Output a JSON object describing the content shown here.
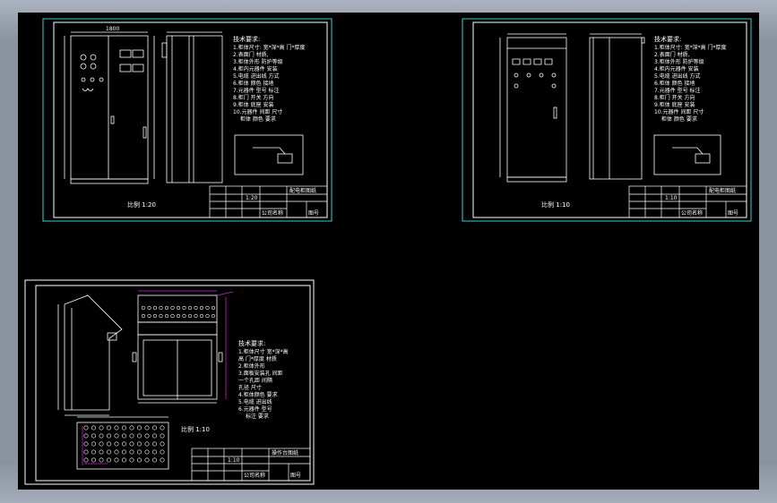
{
  "viewer": {
    "background": "#000000",
    "frame_color": "#8a94a1"
  },
  "colors": {
    "border_cyan": "#35d0d8",
    "line_white": "#ffffff",
    "dim_magenta": "#d020d0",
    "dim_cyan": "#35d0d8"
  },
  "sheets": [
    {
      "caption": "比例 1:20",
      "dim_top": "1800",
      "notes_title": "技术要求:",
      "notes": [
        "1.柜体尺寸: 宽*深*高 门*厚度",
        "2.表面门 材质,",
        "3.柜体外形 防护等级",
        "4.柜内元器件 安装",
        "5.电缆 进出线 方式",
        "6.柜体 颜色 接地",
        "7.元器件 型号 标注",
        "8.柜门 开关 方向",
        "9.柜体 底座 安装",
        "10.元器件 间距 尺寸",
        "柜体 颜色 要求"
      ],
      "titleblock": {
        "name": "配电柜图纸",
        "scale": "1:20",
        "company": "公司名称",
        "drawing_no": "图号"
      }
    },
    {
      "caption": "比例 1:10",
      "dim_top": "",
      "notes_title": "技术要求:",
      "notes": [
        "1.柜体尺寸: 宽*深*高 门*厚度",
        "2.表面门 材质,",
        "3.柜体外形 防护等级",
        "4.柜内元器件 安装",
        "5.电缆 进出线 方式",
        "6.柜体 颜色 接地",
        "7.元器件 型号 标注",
        "8.柜门 开关 方向",
        "9.柜体 底座 安装",
        "10.元器件 间距 尺寸",
        "柜体 颜色 要求"
      ],
      "titleblock": {
        "name": "配电柜图纸",
        "scale": "1:10",
        "company": "公司名称",
        "drawing_no": "图号"
      }
    },
    {
      "caption": "比例 1:10",
      "notes_title": "技术要求:",
      "notes": [
        "1.柜体尺寸 宽*深*高",
        "  高 门*厚度 材质",
        "2.柜体外形",
        "3.面板安装孔 间距",
        "  一个孔距 间隔",
        "  孔径 尺寸",
        "4.柜体颜色 要求",
        "5.电缆 进出线",
        "6.元器件 型号",
        "  标注 要求"
      ],
      "titleblock": {
        "name": "操作台图纸",
        "scale": "1:10",
        "company": "公司名称",
        "drawing_no": "图号"
      }
    }
  ]
}
